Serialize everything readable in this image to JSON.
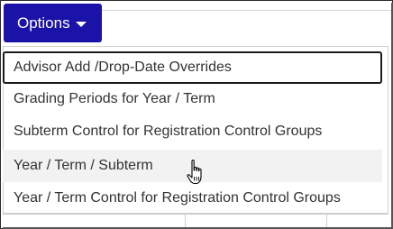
{
  "options_button": {
    "label": "Options",
    "caret_icon": "caret-down-icon"
  },
  "menu": {
    "items": [
      {
        "label": "Advisor Add /Drop-Date Overrides",
        "state": "focused"
      },
      {
        "label": "Grading Periods for Year / Term",
        "state": "normal"
      },
      {
        "label": "Subterm Control for Registration Control Groups",
        "state": "normal"
      },
      {
        "label": "Year / Term / Subterm",
        "state": "hover"
      },
      {
        "label": "Year / Term Control for Registration Control Groups",
        "state": "normal"
      }
    ]
  },
  "pointer": {
    "icon": "hand-pointer-icon"
  },
  "colors": {
    "button_bg": "#1b12a8",
    "button_text": "#ffffff",
    "item_text": "#333333",
    "hover_bg": "#f2f2f2",
    "focus_border": "#1c1c1c"
  }
}
